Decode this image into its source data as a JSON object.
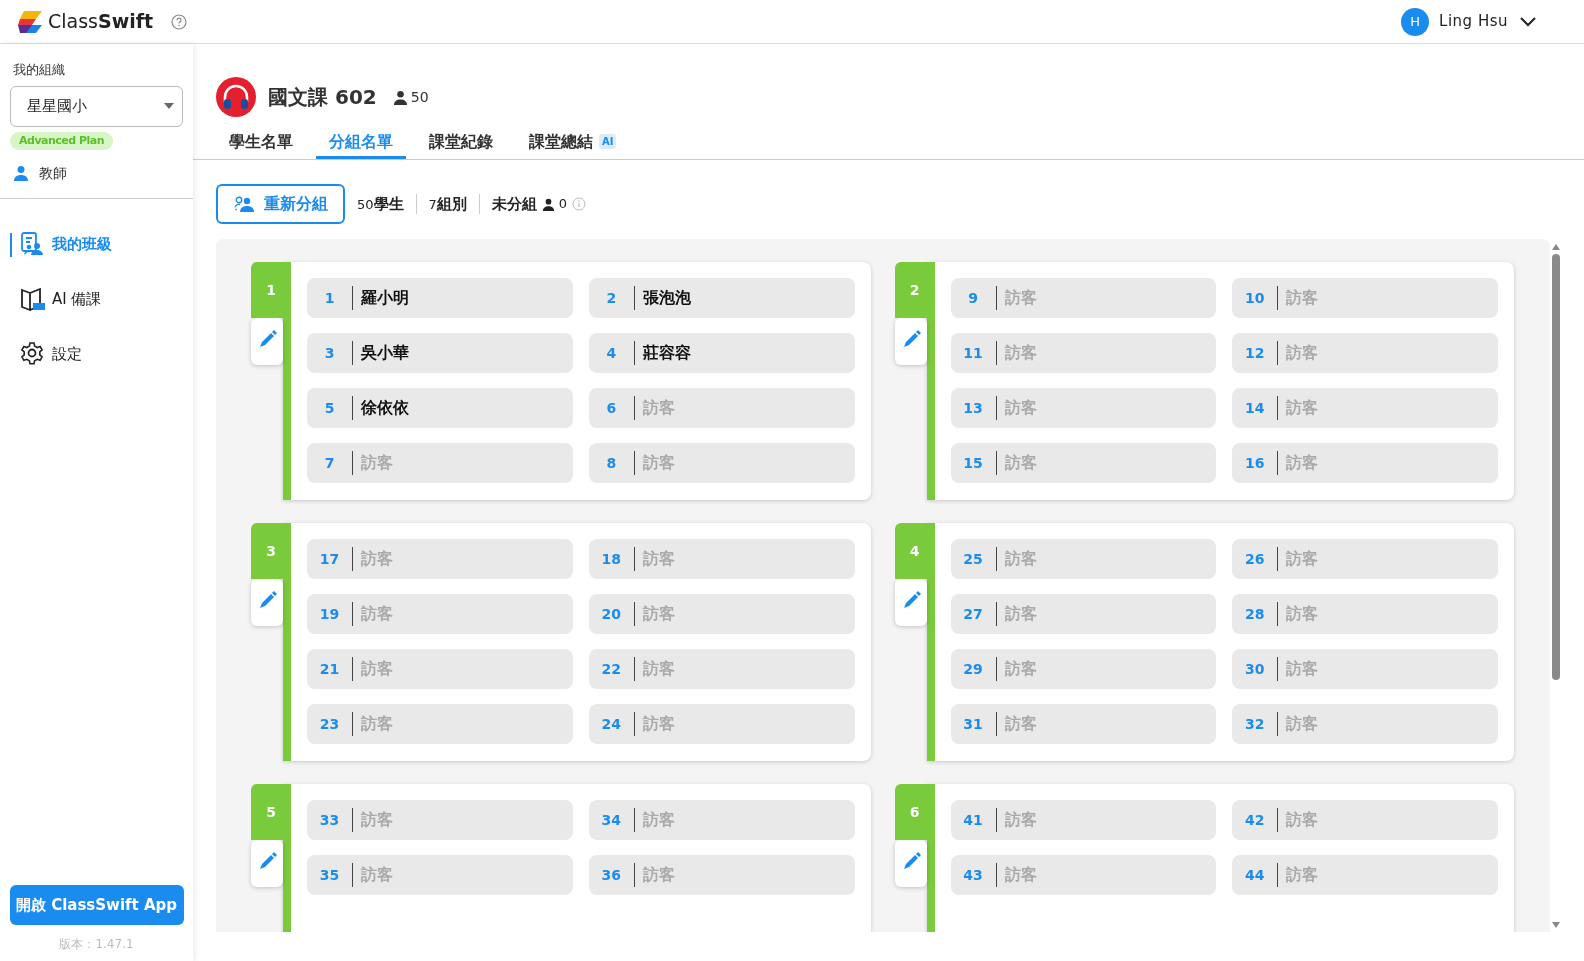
{
  "app": {
    "logo_text_light": "Class",
    "logo_text_bold": "Swift"
  },
  "user": {
    "initial": "H",
    "name": "Ling Hsu"
  },
  "sidebar": {
    "org_label": "我的組織",
    "org_select": "星星國小",
    "plan_badge": "Advanced Plan",
    "role": "教師",
    "items": [
      {
        "label": "我的班級",
        "kind": "class",
        "selected": true
      },
      {
        "label": "AI 備課",
        "kind": "book",
        "selected": false
      },
      {
        "label": "設定",
        "kind": "gear",
        "selected": false
      }
    ],
    "app_button": "開啟 ClassSwift App",
    "version": "版本：1.47.1"
  },
  "class": {
    "title": "國文課 602",
    "count": "50"
  },
  "tabs": [
    {
      "label": "學生名單",
      "selected": false
    },
    {
      "label": "分組名單",
      "selected": true
    },
    {
      "label": "課堂紀錄",
      "selected": false
    },
    {
      "label": "課堂總結",
      "selected": false,
      "badge": "AI"
    }
  ],
  "toolbar": {
    "regroup_button": "重新分組",
    "students_count": "50",
    "students_label": "學生",
    "groups_count": "7",
    "groups_label": "組別",
    "ungrouped_label": "未分組",
    "ungrouped_count": "0"
  },
  "groups": [
    {
      "number": "1",
      "students": [
        {
          "seat": "1",
          "name": "羅小明",
          "guest": false
        },
        {
          "seat": "2",
          "name": "張泡泡",
          "guest": false
        },
        {
          "seat": "3",
          "name": "吳小華",
          "guest": false
        },
        {
          "seat": "4",
          "name": "莊容容",
          "guest": false
        },
        {
          "seat": "5",
          "name": "徐依依",
          "guest": false
        },
        {
          "seat": "6",
          "name": "訪客",
          "guest": true
        },
        {
          "seat": "7",
          "name": "訪客",
          "guest": true
        },
        {
          "seat": "8",
          "name": "訪客",
          "guest": true
        }
      ]
    },
    {
      "number": "2",
      "students": [
        {
          "seat": "9",
          "name": "訪客",
          "guest": true
        },
        {
          "seat": "10",
          "name": "訪客",
          "guest": true
        },
        {
          "seat": "11",
          "name": "訪客",
          "guest": true
        },
        {
          "seat": "12",
          "name": "訪客",
          "guest": true
        },
        {
          "seat": "13",
          "name": "訪客",
          "guest": true
        },
        {
          "seat": "14",
          "name": "訪客",
          "guest": true
        },
        {
          "seat": "15",
          "name": "訪客",
          "guest": true
        },
        {
          "seat": "16",
          "name": "訪客",
          "guest": true
        }
      ]
    },
    {
      "number": "3",
      "students": [
        {
          "seat": "17",
          "name": "訪客",
          "guest": true
        },
        {
          "seat": "18",
          "name": "訪客",
          "guest": true
        },
        {
          "seat": "19",
          "name": "訪客",
          "guest": true
        },
        {
          "seat": "20",
          "name": "訪客",
          "guest": true
        },
        {
          "seat": "21",
          "name": "訪客",
          "guest": true
        },
        {
          "seat": "22",
          "name": "訪客",
          "guest": true
        },
        {
          "seat": "23",
          "name": "訪客",
          "guest": true
        },
        {
          "seat": "24",
          "name": "訪客",
          "guest": true
        }
      ]
    },
    {
      "number": "4",
      "students": [
        {
          "seat": "25",
          "name": "訪客",
          "guest": true
        },
        {
          "seat": "26",
          "name": "訪客",
          "guest": true
        },
        {
          "seat": "27",
          "name": "訪客",
          "guest": true
        },
        {
          "seat": "28",
          "name": "訪客",
          "guest": true
        },
        {
          "seat": "29",
          "name": "訪客",
          "guest": true
        },
        {
          "seat": "30",
          "name": "訪客",
          "guest": true
        },
        {
          "seat": "31",
          "name": "訪客",
          "guest": true
        },
        {
          "seat": "32",
          "name": "訪客",
          "guest": true
        }
      ]
    },
    {
      "number": "5",
      "students": [
        {
          "seat": "33",
          "name": "訪客",
          "guest": true
        },
        {
          "seat": "34",
          "name": "訪客",
          "guest": true
        },
        {
          "seat": "35",
          "name": "訪客",
          "guest": true
        },
        {
          "seat": "36",
          "name": "訪客",
          "guest": true
        }
      ]
    },
    {
      "number": "6",
      "students": [
        {
          "seat": "41",
          "name": "訪客",
          "guest": true
        },
        {
          "seat": "42",
          "name": "訪客",
          "guest": true
        },
        {
          "seat": "43",
          "name": "訪客",
          "guest": true
        },
        {
          "seat": "44",
          "name": "訪客",
          "guest": true
        }
      ]
    }
  ]
}
